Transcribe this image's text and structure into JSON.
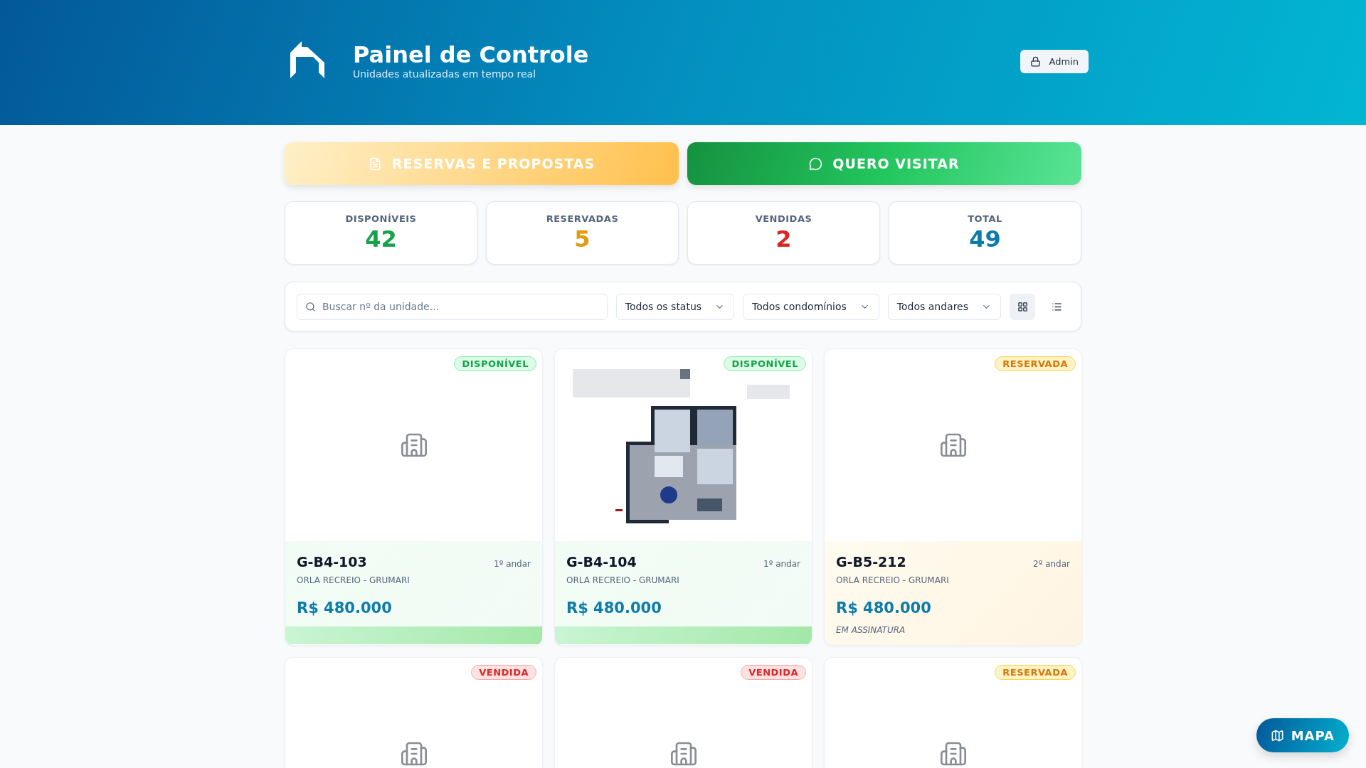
{
  "header": {
    "title": "Painel de Controle",
    "subtitle": "Unidades atualizadas em tempo real",
    "admin_button": "Admin"
  },
  "actions": [
    {
      "kind": "proposals",
      "label": "RESERVAS E PROPOSTAS"
    },
    {
      "kind": "visit",
      "label": "QUERO VISITAR"
    }
  ],
  "stats": [
    {
      "label": "DISPONÍVEIS",
      "value": "42",
      "color": "#16a34a"
    },
    {
      "label": "RESERVADAS",
      "value": "5",
      "color": "#e39a0c"
    },
    {
      "label": "VENDIDAS",
      "value": "2",
      "color": "#dc2626"
    },
    {
      "label": "TOTAL",
      "value": "49",
      "color": "#0e7cab"
    }
  ],
  "filters": {
    "search": {
      "placeholder": "Buscar nº da unidade..."
    },
    "selects": [
      "Todos os status",
      "Todos condomínios",
      "Todos andares"
    ],
    "view_modes": [
      {
        "kind": "grid",
        "selected": true
      },
      {
        "kind": "list",
        "selected": false
      }
    ]
  },
  "units": [
    {
      "kind": "available",
      "badge": "DISPONÍVEL",
      "has_picture": false,
      "code": "G-B4-103",
      "floor": "1º andar",
      "project": "ORLA RECREIO - GRUMARI",
      "price": "R$ 480.000"
    },
    {
      "kind": "available",
      "badge": "DISPONÍVEL",
      "has_picture": true,
      "code": "G-B4-104",
      "floor": "1º andar",
      "project": "ORLA RECREIO - GRUMARI",
      "price": "R$ 480.000"
    },
    {
      "kind": "reserved",
      "badge": "RESERVADA",
      "has_picture": false,
      "code": "G-B5-212",
      "floor": "2º andar",
      "project": "ORLA RECREIO - GRUMARI",
      "price": "R$ 480.000",
      "note": "EM ASSINATURA"
    },
    {
      "kind": "sold",
      "badge": "VENDIDA",
      "has_picture": false
    },
    {
      "kind": "sold",
      "badge": "VENDIDA",
      "has_picture": false
    },
    {
      "kind": "reserved",
      "badge": "RESERVADA",
      "has_picture": false
    }
  ],
  "map_button": "MAPA"
}
